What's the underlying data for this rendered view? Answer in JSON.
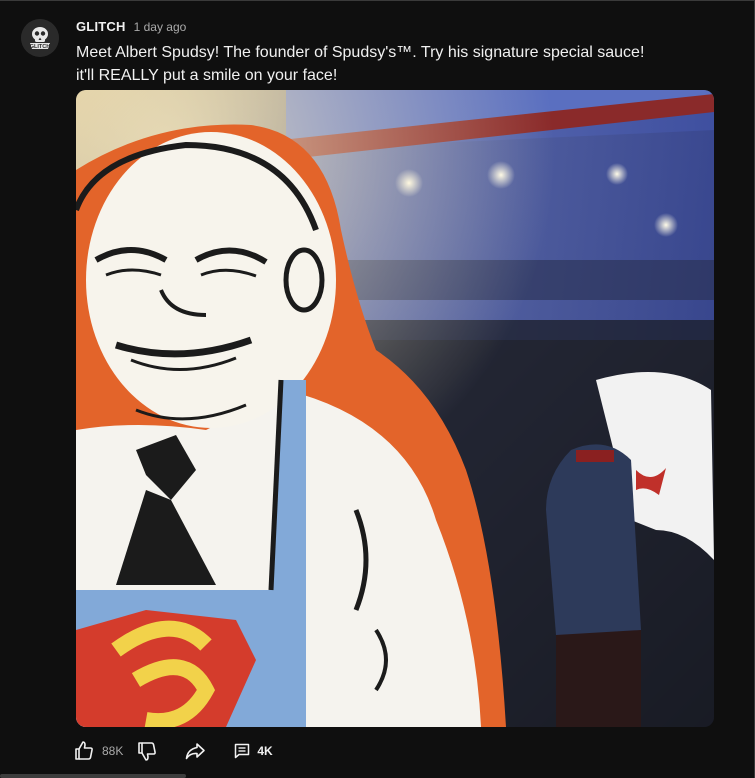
{
  "post": {
    "channel_name": "GLITCH",
    "timestamp": "1 day ago",
    "avatar_text": "GLITCH",
    "text_line1": "Meet Albert Spudsy! The founder of Spudsy's™. Try his signature special sauce!",
    "text_line2": "it'll REALLY put a smile on your face!"
  },
  "actions": {
    "like_count": "88K",
    "comment_count": "4K",
    "like_icon": "thumbs-up-icon",
    "dislike_icon": "thumbs-down-icon",
    "share_icon": "share-icon",
    "comment_icon": "comment-icon"
  },
  "colors": {
    "background": "#0f0f0f",
    "text": "#f1f1f1",
    "muted": "#aaaaaa"
  }
}
